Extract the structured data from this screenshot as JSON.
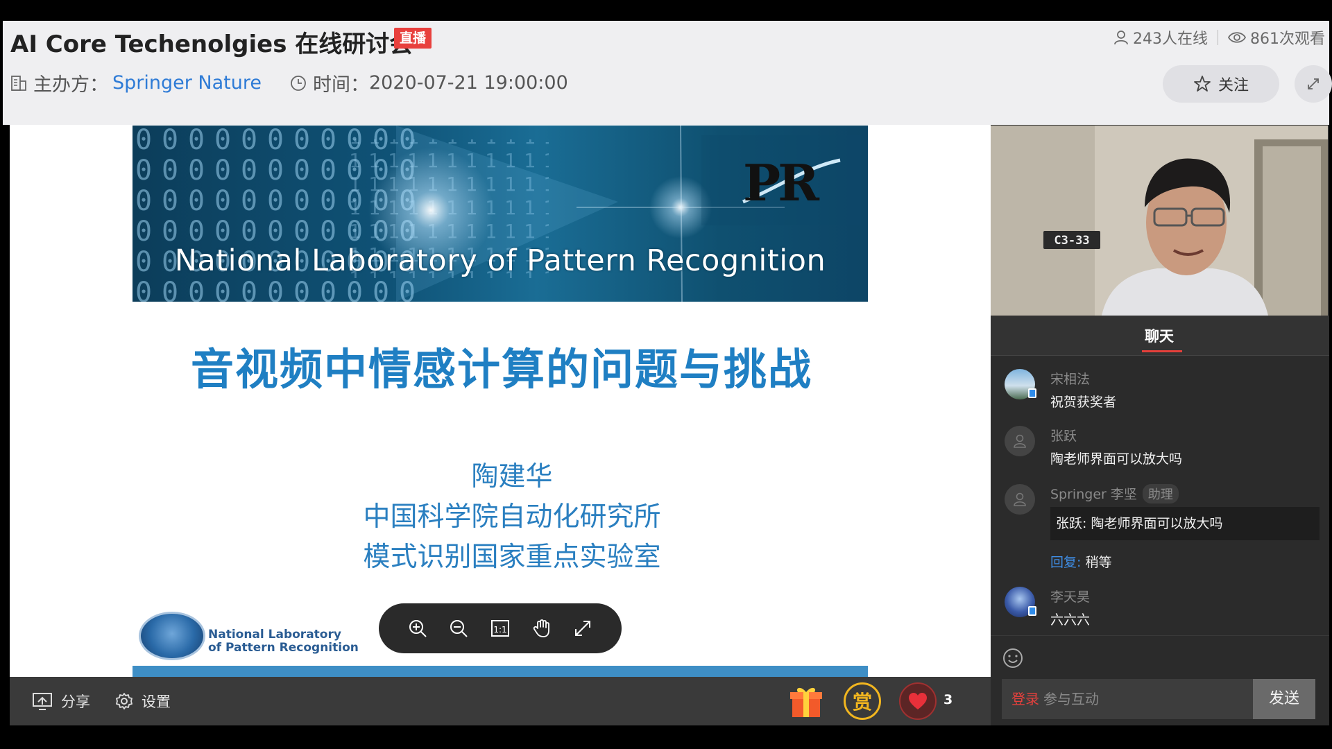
{
  "header": {
    "title": "AI Core Techenolgies 在线研讨会",
    "live_badge": "直播",
    "online_count": "243人在线",
    "view_count": "861次观看",
    "organizer_label": "主办方：",
    "organizer_name": "Springer Nature",
    "time_label": "时间：",
    "time_value": "2020-07-21 19:00:00",
    "follow_label": "关注"
  },
  "slide": {
    "banner_text": "National Laboratory of Pattern Recognition",
    "banner_logo": "PR",
    "title": "音视频中情感计算的问题与挑战",
    "author": "陶建华",
    "affiliation_1": "中国科学院自动化研究所",
    "affiliation_2": "模式识别国家重点实验室",
    "lab_logo_text_1": "National Laboratory",
    "lab_logo_text_2": "of Pattern Recognition"
  },
  "zoom_toolbar": {
    "tools": [
      "zoom-in-icon",
      "zoom-out-icon",
      "actual-size-icon",
      "hand-pan-icon",
      "expand-icon"
    ],
    "actual_size_glyph": "1:1"
  },
  "controls": {
    "share_label": "分享",
    "settings_label": "设置",
    "reward_label": "赏",
    "like_count": "3"
  },
  "video": {
    "room_sign": "C3-33"
  },
  "chat": {
    "tab_label": "聊天",
    "messages": [
      {
        "name": "宋相法",
        "text": "祝贺获奖者"
      },
      {
        "name": "张跃",
        "text": "陶老师界面可以放大吗"
      },
      {
        "name": "Springer 李坚",
        "role": "助理",
        "quote": "张跃: 陶老师界面可以放大吗",
        "reply_label": "回复:",
        "reply_text": "稍等"
      },
      {
        "name": "李天昊",
        "text": "六六六"
      }
    ],
    "login_label": "登录",
    "input_placeholder": "参与互动",
    "send_label": "发送"
  },
  "colors": {
    "accent_blue": "#2e7bd6",
    "live_red": "#e8403d",
    "slide_blue": "#1f7fc3",
    "chat_bg": "#2b2b2b"
  }
}
